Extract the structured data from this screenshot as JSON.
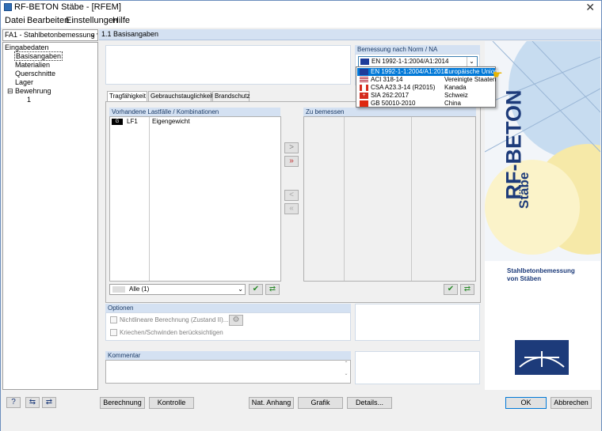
{
  "window": {
    "title": "RF-BETON Stäbe - [RFEM]"
  },
  "menu": [
    "Datei",
    "Bearbeiten",
    "Einstellungen",
    "Hilfe"
  ],
  "left": {
    "combo": "FA1 - Stahlbetonbemessung vo",
    "tree": [
      "Eingabedaten",
      "Basisangaben",
      "Materialien",
      "Querschnitte",
      "Lager",
      "Bewehrung",
      "1"
    ]
  },
  "header": "1.1 Basisangaben",
  "norm": {
    "label": "Bemessung nach Norm / NA",
    "selected": "EN 1992-1-1:2004/A1:2014",
    "options": [
      {
        "code": "EN 1992-1-1:2004/A1:2014",
        "country": "Europäische Union"
      },
      {
        "code": "ACI 318-14",
        "country": "Vereinigte Staaten"
      },
      {
        "code": "CSA A23.3-14 (R2015)",
        "country": "Kanada"
      },
      {
        "code": "SIA 262:2017",
        "country": "Schweiz"
      },
      {
        "code": "GB 50010-2010",
        "country": "China"
      }
    ]
  },
  "tabs": [
    "Tragfähigkeit",
    "Gebrauchstauglichkeit",
    "Brandschutz"
  ],
  "loads": {
    "title": "Vorhandene Lastfälle / Kombinationen",
    "row": {
      "tag": "G",
      "id": "LF1",
      "name": "Eigengewicht"
    },
    "filter": "Alle (1)"
  },
  "design": {
    "title": "Zu bemessen"
  },
  "move": {
    "add": ">",
    "add_all": "»",
    "remove": "<",
    "remove_all": "«"
  },
  "options": {
    "title": "Optionen",
    "nonlinear": "Nichtlineare Berechnung (Zustand II)...",
    "creep": "Kriechen/Schwinden berücksichtigen"
  },
  "comment": {
    "title": "Kommentar"
  },
  "brand": {
    "name": "RF-BETON",
    "sub": "Stäbe",
    "desc1": "Stahlbetonbemessung",
    "desc2": "von Stäben"
  },
  "buttons": {
    "berechnung": "Berechnung",
    "kontrolle": "Kontrolle",
    "anhang": "Nat. Anhang",
    "grafik": "Grafik",
    "details": "Details...",
    "ok": "OK",
    "abbrechen": "Abbrechen"
  }
}
